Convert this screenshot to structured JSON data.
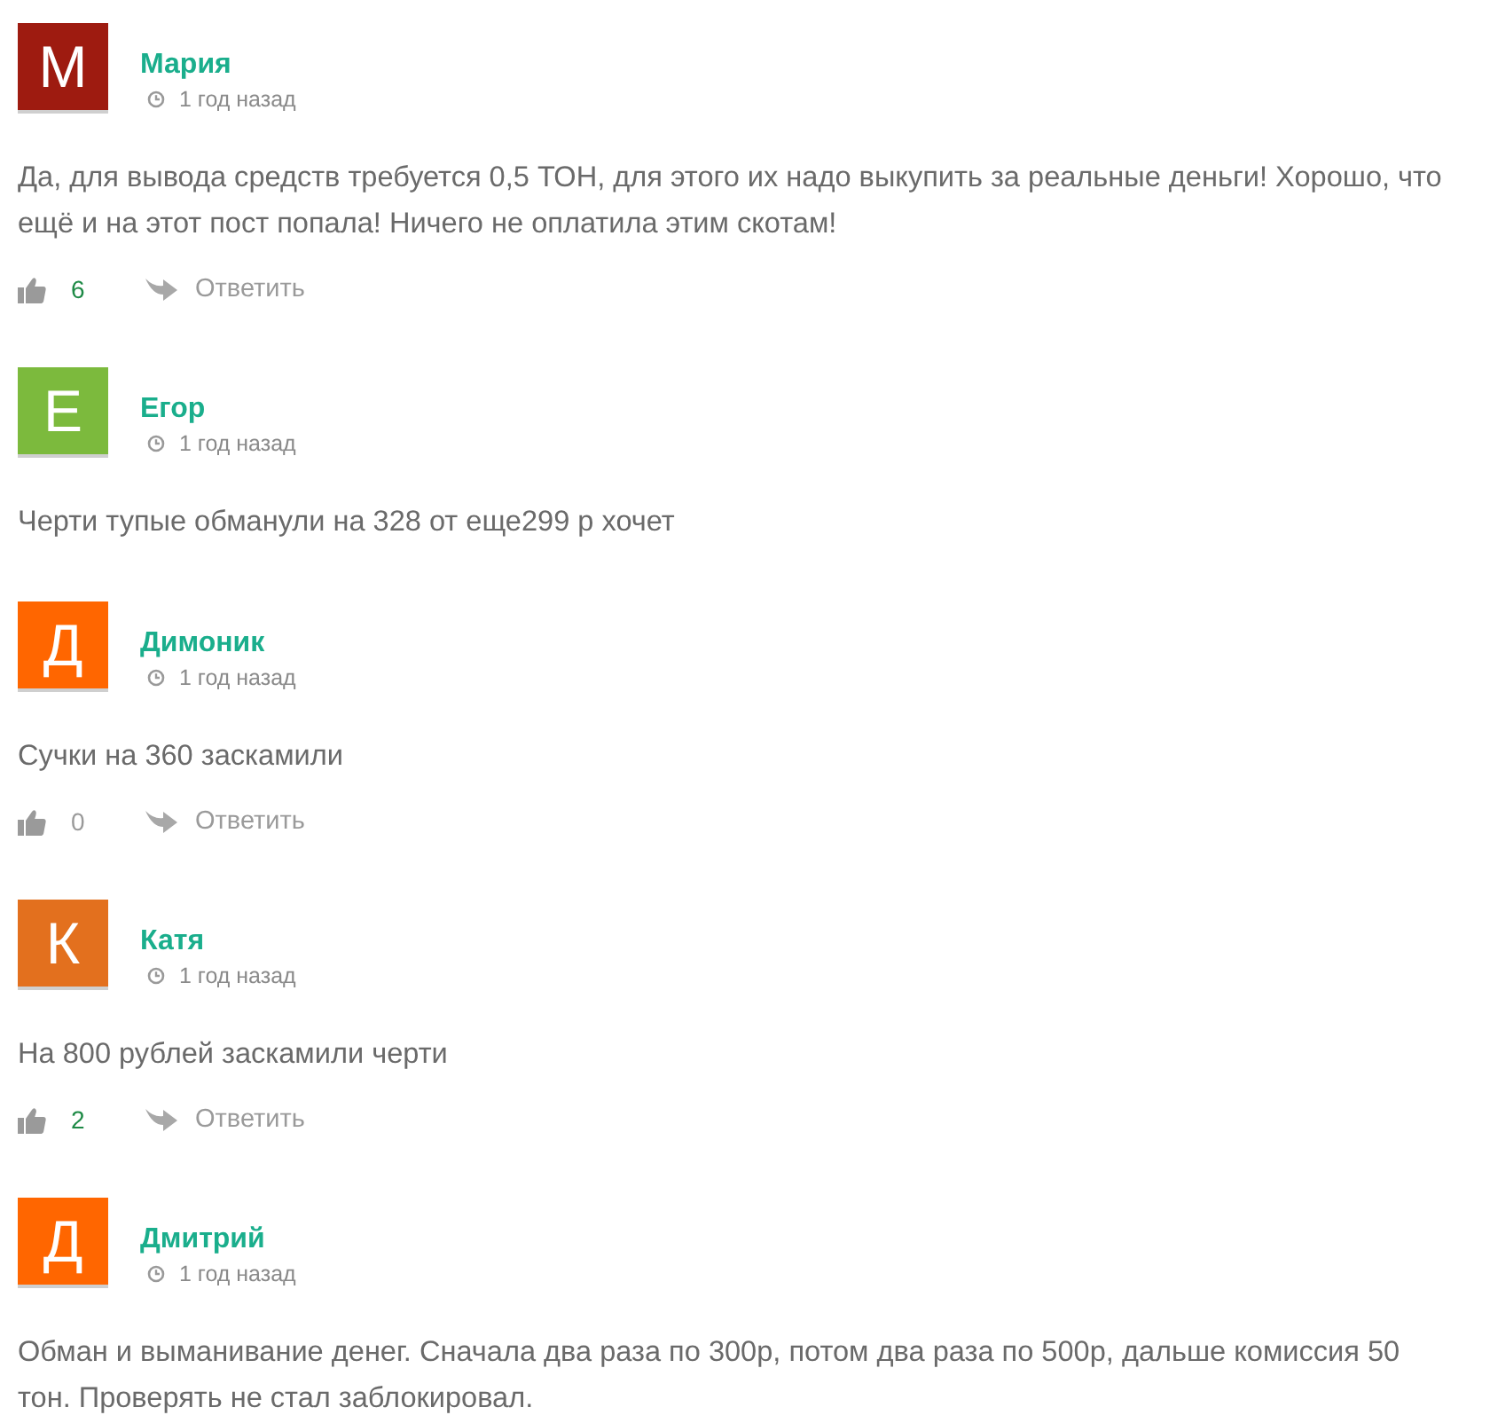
{
  "comments": [
    {
      "author": "Мария",
      "initial": "М",
      "color": "#9e1b10",
      "time": "1 год назад",
      "text": "Да, для вывода средств требуется 0,5 ТОН, для этого их надо выкупить за реальные деньги! Хорошо, что ещё и на этот пост попала! Ничего не оплатила этим скотам!",
      "actions": {
        "likes": "6",
        "positive": true,
        "reply": "Ответить"
      }
    },
    {
      "author": "Егор",
      "initial": "Е",
      "color": "#7cba3d",
      "time": "1 год назад",
      "text": "Черти тупые обманули на 328 от еще299 р хочет"
    },
    {
      "author": "Димоник",
      "initial": "Д",
      "color": "#ff6600",
      "time": "1 год назад",
      "text": "Сучки на 360 заскамили",
      "actions": {
        "likes": "0",
        "positive": false,
        "reply": "Ответить"
      }
    },
    {
      "author": "Катя",
      "initial": "К",
      "color": "#e3701e",
      "time": "1 год назад",
      "text": "На 800 рублей заскамили черти",
      "actions": {
        "likes": "2",
        "positive": true,
        "reply": "Ответить"
      }
    },
    {
      "author": "Дмитрий",
      "initial": "Д",
      "color": "#ff6600",
      "time": "1 год назад",
      "text": "Обман и выманивание денег. Сначала два раза по 300р, потом два раза по 500р, дальше комиссия 50 тон. Проверять не стал заблокировал."
    }
  ]
}
